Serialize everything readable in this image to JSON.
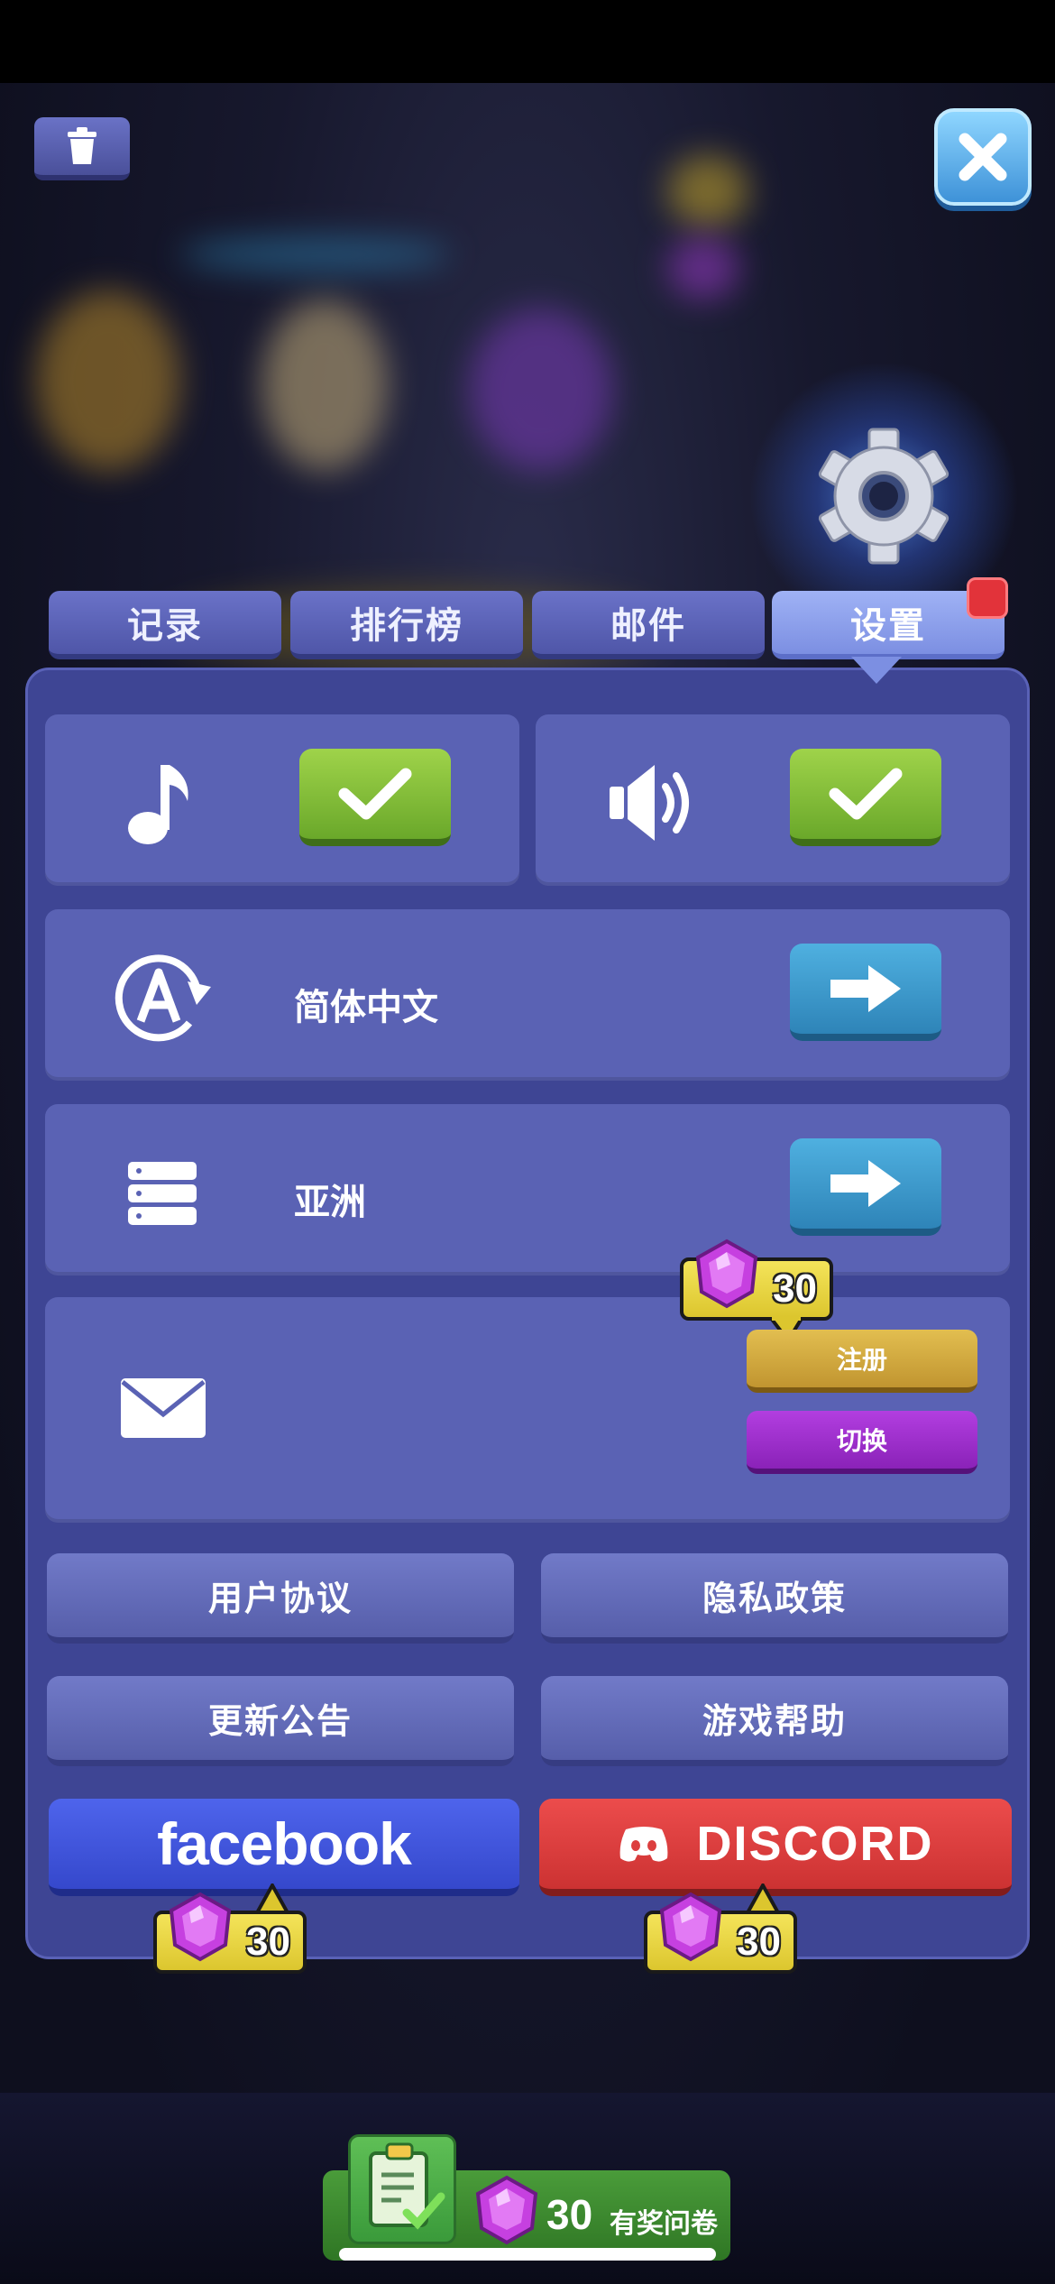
{
  "tabs": [
    {
      "label": "记录",
      "active": false
    },
    {
      "label": "排行榜",
      "active": false
    },
    {
      "label": "邮件",
      "active": false
    },
    {
      "label": "设置",
      "active": true
    }
  ],
  "settings": {
    "music": {
      "icon": "music-note-icon",
      "enabled": true
    },
    "sound": {
      "icon": "speaker-icon",
      "enabled": true
    },
    "language": {
      "icon": "language-icon",
      "value": "简体中文"
    },
    "server": {
      "icon": "server-icon",
      "value": "亚洲"
    },
    "account": {
      "icon": "mail-icon",
      "register_label": "注册",
      "switch_label": "切换",
      "reward": "30"
    }
  },
  "links": {
    "user_agreement": "用户协议",
    "privacy_policy": "隐私政策",
    "update_notice": "更新公告",
    "game_help": "游戏帮助"
  },
  "social": {
    "facebook_label": "facebook",
    "facebook_reward": "30",
    "discord_label": "DISCORD",
    "discord_reward": "30"
  },
  "survey": {
    "reward": "30",
    "label": "有奖问卷"
  },
  "colors": {
    "panel": "#3e4594",
    "card": "#5a62b4",
    "toggle_on": "#7ab836",
    "arrow_button": "#3a98cc",
    "register": "#d2aa3e",
    "switch": "#9d2ecc",
    "facebook": "#4257dc",
    "discord": "#dc3e3e",
    "reward_tag": "#eed640",
    "gem": "#c640e0"
  }
}
